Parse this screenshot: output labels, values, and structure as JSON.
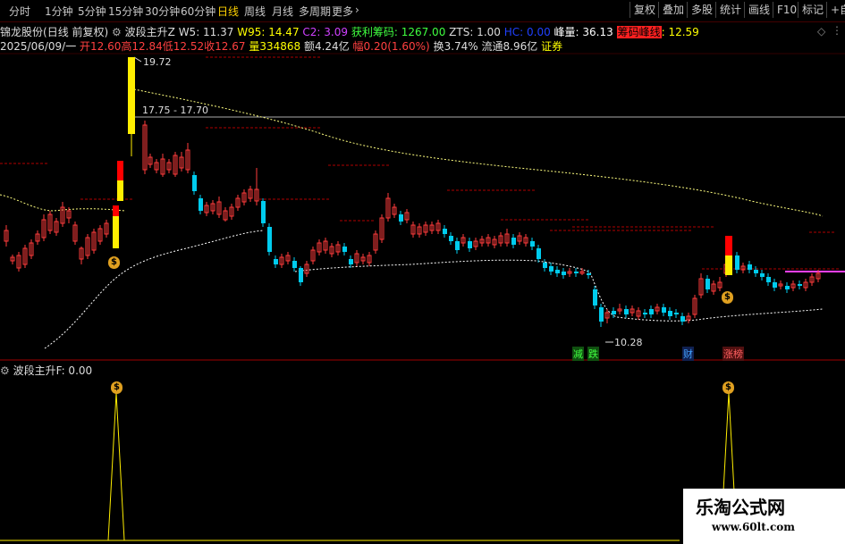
{
  "toolbar": {
    "periods": [
      "分时",
      "1分钟",
      "5分钟",
      "15分钟",
      "30分钟",
      "60分钟",
      "日线",
      "周线",
      "月线",
      "多周期",
      "更多"
    ],
    "active": "日线",
    "right_buttons": [
      "复权",
      "叠加",
      "多股",
      "统计",
      "画线",
      "F10",
      "标记",
      "+自"
    ]
  },
  "info_row1": {
    "stock": "锦龙股份",
    "mode": "(日线 前复权)",
    "indicator": "波段主升Z",
    "w5": "W5: 11.37",
    "w95": "W95: 14.47",
    "c2": "C2: 3.09",
    "profit": "获利筹码: 1267.00",
    "zts": "ZTS: 1.00",
    "hc": "HC: 0.00",
    "peak": "峰量: 36.13",
    "chip_peak_label": "筹码峰线",
    "chip_peak_value": ": 12.59"
  },
  "info_row2": {
    "date": "2025/06/09/一",
    "open": "开12.60",
    "high": "高12.84",
    "low": "低12.52",
    "close": "收12.67",
    "volume": "量334868",
    "amount": "额4.24亿",
    "change": "幅0.20(1.60%)",
    "turnover": "换3.74%",
    "float": "流通8.96亿",
    "sector": "证券"
  },
  "annotations": {
    "high_price": "19.72",
    "range": "17.75 - 17.70",
    "low_price": "10.28",
    "tag_jian": "减",
    "tag_die": "跌",
    "tag_cai": "财",
    "tag_zhang": "涨榜",
    "money_icon": "$"
  },
  "sub_panel": {
    "title": "波段主升F",
    "value": ": 0.00"
  },
  "watermark": {
    "title": "乐淘公式网",
    "url": "www.60lt.com"
  },
  "colors": {
    "up": "#ff3c3c",
    "down": "#00ccee",
    "signal": "#ffee00",
    "signal_red": "#ff0000",
    "ma": "#ffffff",
    "ma2": "#ffff80",
    "chip": "#ff40ff"
  }
}
